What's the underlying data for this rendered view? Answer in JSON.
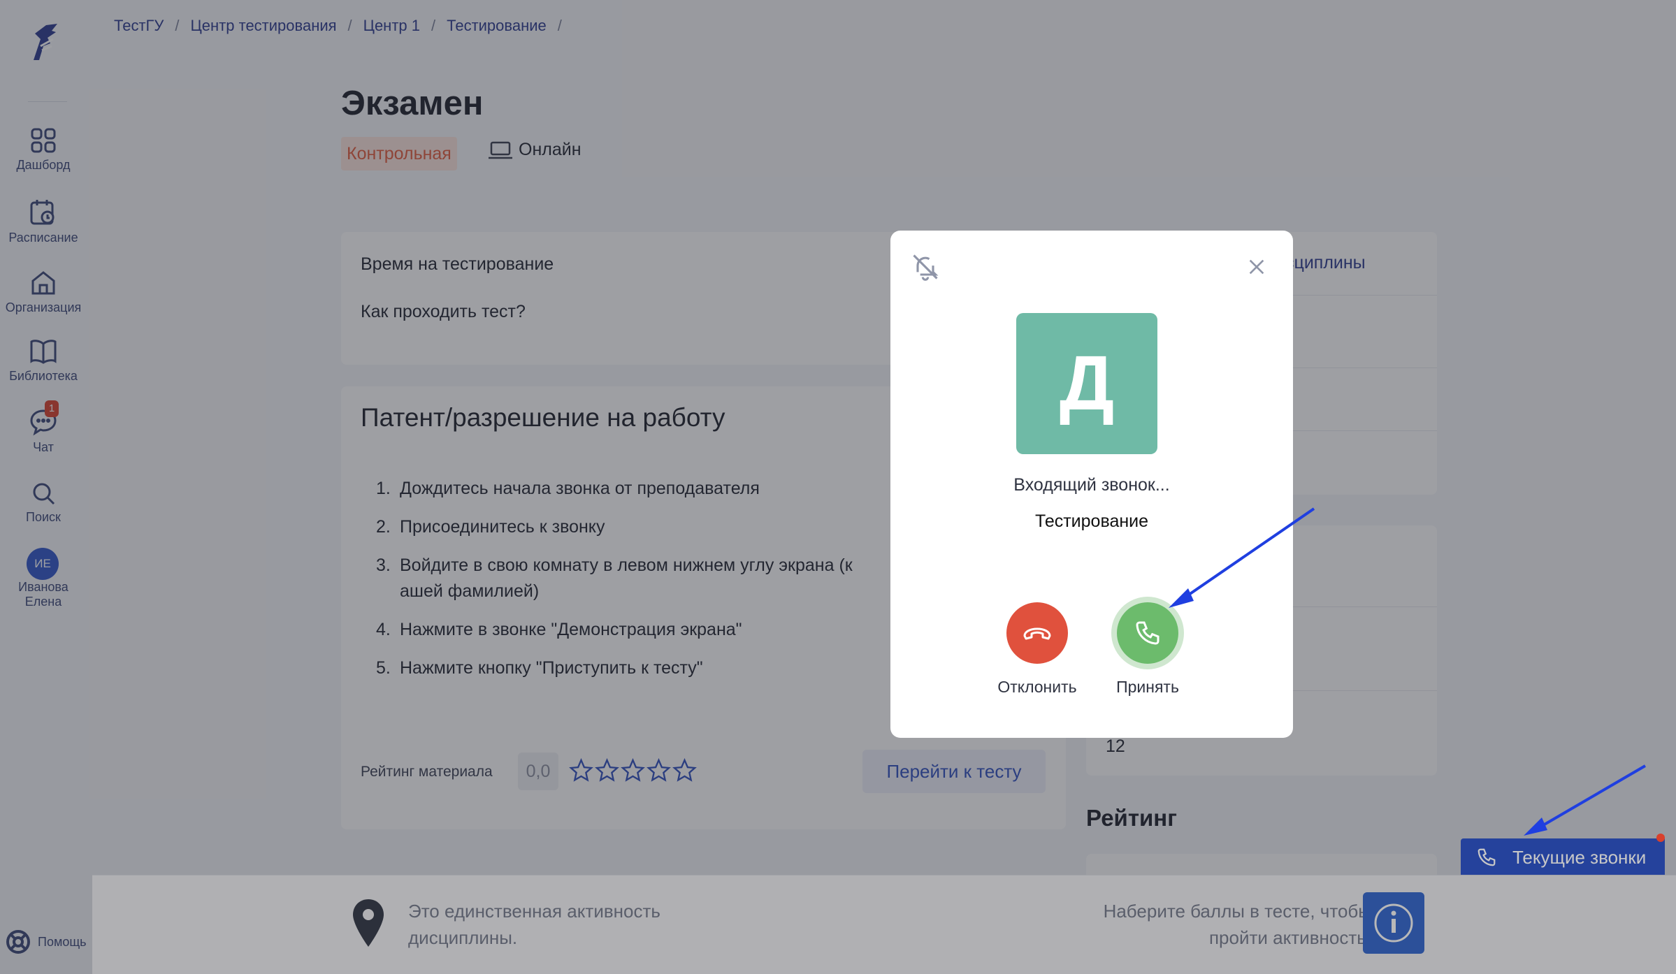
{
  "sidebar": {
    "items": [
      {
        "label": "Дашборд",
        "icon": "grid-icon"
      },
      {
        "label": "Расписание",
        "icon": "calendar-clock-icon"
      },
      {
        "label": "Организация",
        "icon": "home-icon"
      },
      {
        "label": "Библиотека",
        "icon": "book-icon"
      },
      {
        "label": "Чат",
        "icon": "chat-icon",
        "badge": "1"
      },
      {
        "label": "Поиск",
        "icon": "search-icon"
      }
    ],
    "user": {
      "initials": "ИЕ",
      "name_line1": "Иванова",
      "name_line2": "Елена"
    },
    "help": "Помощь"
  },
  "breadcrumb": [
    "ТестГУ",
    "Центр тестирования",
    "Центр 1",
    "Тестирование"
  ],
  "page": {
    "title": "Экзамен",
    "tag": "Контрольная",
    "mode": "Онлайн"
  },
  "info_card": {
    "time_label": "Время на тестирование",
    "how_label": "Как проходить тест?"
  },
  "material": {
    "title": "Патент/разрешение на работу",
    "steps": [
      "Дождитесь начала звонка от преподавателя",
      "Присоединитесь к звонку",
      "Войдите в свою комнату в левом нижнем углу экрана (к",
      "ашей фамилией)",
      "Нажмите в звонке \"Демонстрация экрана\"",
      "Нажмите кнопку \"Приступить к тесту\""
    ],
    "rating_label": "Рейтинг материала",
    "rating_value": "0,0",
    "stars": 0,
    "go_button": "Перейти к тесту"
  },
  "right": {
    "disciplines_link": "сциплины",
    "value": "12",
    "rating_heading": "Рейтинг"
  },
  "banner": {
    "left_text": "Это единственная активность дисциплины.",
    "right_text": "Наберите баллы в тесте, чтобы пройти активность."
  },
  "calls_button": "Текущие звонки",
  "modal": {
    "avatar_letter": "Д",
    "subtitle": "Входящий звонок...",
    "caller": "Тестирование",
    "decline_label": "Отклонить",
    "accept_label": "Принять"
  },
  "colors": {
    "accent": "#2f55c8",
    "decline": "#e0513d",
    "accept": "#6cbb6c",
    "avatar": "#6fbaa6",
    "arrow": "#1f3fe0"
  }
}
